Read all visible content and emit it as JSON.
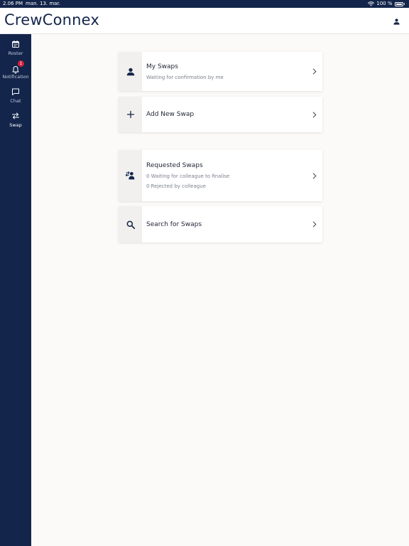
{
  "status_bar": {
    "time": "2.06 PM",
    "date": "man. 13. mar.",
    "battery": "100 %"
  },
  "app": {
    "title": "CrewConnex"
  },
  "sidebar": {
    "items": [
      {
        "label": "Roster",
        "icon": "calendar-icon"
      },
      {
        "label": "Notification",
        "icon": "bell-icon",
        "badge": "1"
      },
      {
        "label": "Chat",
        "icon": "chat-icon"
      },
      {
        "label": "Swap",
        "icon": "swap-arrows-icon",
        "active": true
      }
    ]
  },
  "cards": {
    "my_swaps": {
      "title": "My Swaps",
      "subtitle": "Waiting for confirmation by me",
      "icon": "person-icon"
    },
    "add_new_swap": {
      "title": "Add New Swap",
      "icon": "plus-icon"
    },
    "requested_swaps": {
      "title": "Requested Swaps",
      "line1": "0 Waiting for colleague to finalise",
      "line2": "0 Rejected by colleague",
      "icon": "people-swap-icon"
    },
    "search_swaps": {
      "title": "Search for Swaps",
      "icon": "search-icon"
    }
  },
  "colors": {
    "navy": "#13254b",
    "background": "#fbfaf8",
    "badge": "#d3203a"
  }
}
